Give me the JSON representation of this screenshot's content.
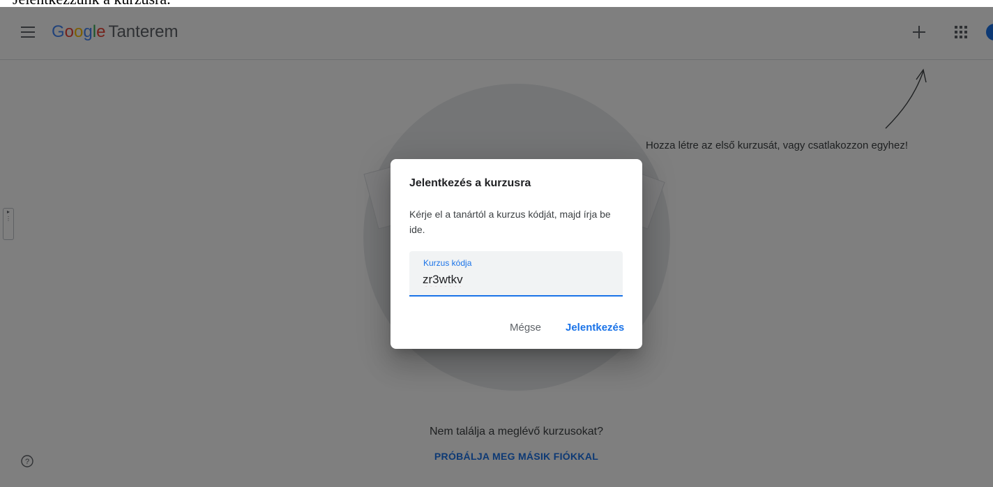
{
  "top_strip_text": "Jelentkezzünk a kurzusra.",
  "header": {
    "logo_google": [
      "G",
      "o",
      "o",
      "g",
      "l",
      "e"
    ],
    "logo_product": "Tanterem"
  },
  "hint_text": "Hozza létre az első kurzusát, vagy csatlakozzon egyhez!",
  "footer": {
    "question": "Nem találja a meglévő kurzusokat?",
    "link": "PRÓBÁLJA MEG MÁSIK FIÓKKAL"
  },
  "dialog": {
    "title": "Jelentkezés a kurzusra",
    "body": "Kérje el a tanártól a kurzus kódját, majd írja be ide.",
    "field_label": "Kurzus kódja",
    "field_value": "zr3wtkv",
    "cancel_label": "Mégse",
    "join_label": "Jelentkezés"
  },
  "colors": {
    "accent": "#1a73e8",
    "scrim": "rgba(0,0,0,0.5)"
  },
  "icons": {
    "menu": "hamburger-menu-icon",
    "add": "plus-icon",
    "apps": "apps-grid-icon",
    "help": "help-circle-icon",
    "arrow": "hand-drawn-arrow-icon"
  }
}
